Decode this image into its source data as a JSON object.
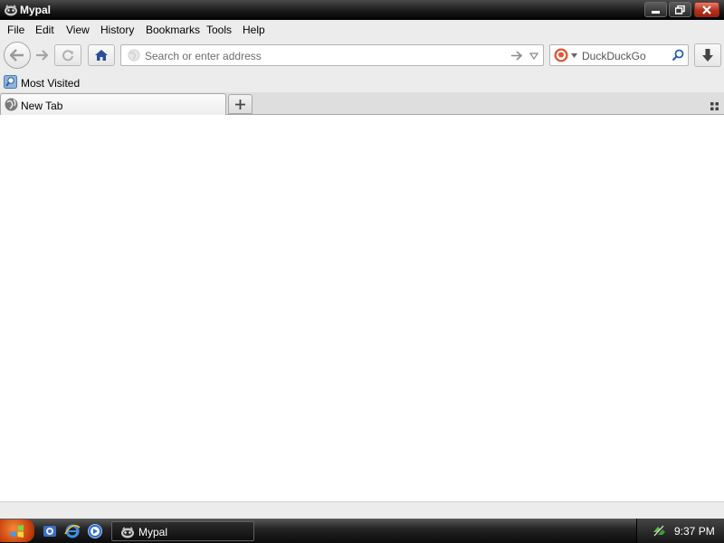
{
  "window": {
    "title": "Mypal"
  },
  "menu": {
    "file": "File",
    "edit": "Edit",
    "view": "View",
    "history": "History",
    "bookmarks": "Bookmarks",
    "tools": "Tools",
    "help": "Help"
  },
  "navbar": {
    "address_placeholder": "Search or enter address",
    "search_engine": "DuckDuckGo"
  },
  "bookmarks_toolbar": {
    "item": "Most Visited"
  },
  "tabs": [
    {
      "label": "New Tab"
    }
  ],
  "taskbar": {
    "task_label": "Mypal",
    "clock": "9:37 PM"
  }
}
